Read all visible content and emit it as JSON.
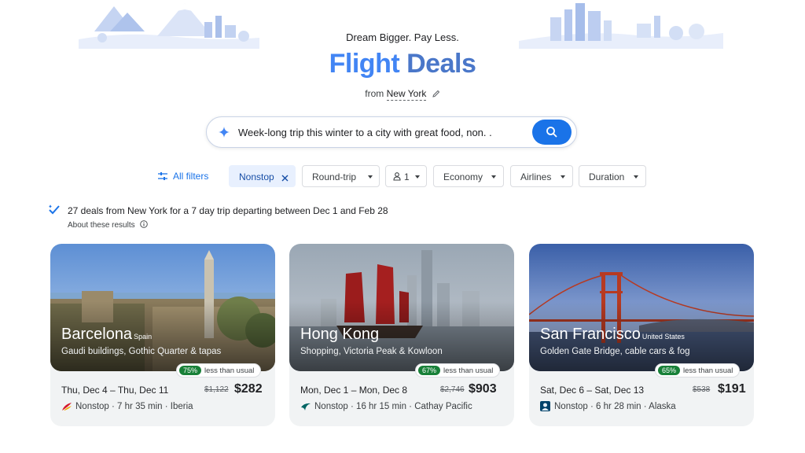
{
  "header": {
    "tagline": "Dream Bigger. Pay Less.",
    "title_word1": "Flight",
    "title_word2": "Deals",
    "from_label": "from",
    "origin_city": "New York"
  },
  "search": {
    "query": "Week-long trip this winter to a city with great food, non. ."
  },
  "filters": {
    "all_filters": "All filters",
    "nonstop": "Nonstop",
    "trip_type": "Round-trip",
    "passengers": "1",
    "cabin": "Economy",
    "airlines": "Airlines",
    "duration": "Duration"
  },
  "results": {
    "summary": "27 deals from New York for a 7 day trip departing between Dec 1 and Feb 28",
    "about": "About these results"
  },
  "deals": [
    {
      "city": "Barcelona",
      "country": "Spain",
      "blurb": "Gaudi buildings, Gothic Quarter & tapas",
      "discount": "75%",
      "discount_note": "less than usual",
      "dates": "Thu, Dec 4 – Thu, Dec 11",
      "old_price": "$1,122",
      "price": "$282",
      "details": "Nonstop · 7 hr 35 min · Iberia",
      "airline_icon": "iberia-logo-icon"
    },
    {
      "city": "Hong Kong",
      "country": "",
      "blurb": "Shopping, Victoria Peak & Kowloon",
      "discount": "67%",
      "discount_note": "less than usual",
      "dates": "Mon, Dec 1 – Mon, Dec 8",
      "old_price": "$2,746",
      "price": "$903",
      "details": "Nonstop · 16 hr 15 min · Cathay Pacific",
      "airline_icon": "cathay-pacific-logo-icon"
    },
    {
      "city": "San Francisco",
      "country": "United States",
      "blurb": "Golden Gate Bridge, cable cars & fog",
      "discount": "65%",
      "discount_note": "less than usual",
      "dates": "Sat, Dec 6 – Sat, Dec 13",
      "old_price": "$538",
      "price": "$191",
      "details": "Nonstop · 6 hr 28 min · Alaska",
      "airline_icon": "alaska-logo-icon"
    }
  ],
  "colors": {
    "accent": "#1a73e8",
    "title_blue": "#4285f4",
    "discount_green": "#188038",
    "card_bg": "#f1f3f4",
    "chip_active_bg": "#e8f0fe"
  }
}
